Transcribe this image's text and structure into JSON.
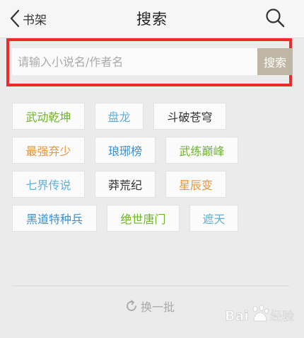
{
  "header": {
    "back_label": "书架",
    "title": "搜索"
  },
  "search": {
    "placeholder": "请输入小说名/作者名",
    "button_label": "搜索"
  },
  "tags": [
    {
      "label": "武动乾坤",
      "color": "#6bb52a"
    },
    {
      "label": "盘龙",
      "color": "#5fb0de"
    },
    {
      "label": "斗破苍穹",
      "color": "#333333"
    },
    {
      "label": "最强弃少",
      "color": "#e8963a"
    },
    {
      "label": "琅琊榜",
      "color": "#3a8fd0"
    },
    {
      "label": "武练巅峰",
      "color": "#6bb52a"
    },
    {
      "label": "七界传说",
      "color": "#5fb0de"
    },
    {
      "label": "莽荒纪",
      "color": "#333333"
    },
    {
      "label": "星辰变",
      "color": "#e8963a"
    },
    {
      "label": "黑道特种兵",
      "color": "#3a8fd0"
    },
    {
      "label": "绝世唐门",
      "color": "#6bb52a"
    },
    {
      "label": "遮天",
      "color": "#5fb0de"
    }
  ],
  "refresh": {
    "label": "换一批",
    "icon": "refresh-icon"
  },
  "watermark": {
    "text": "Bai经验"
  },
  "colors": {
    "highlight_border": "#ee2a2a",
    "search_button_bg": "#bfb7a3"
  }
}
